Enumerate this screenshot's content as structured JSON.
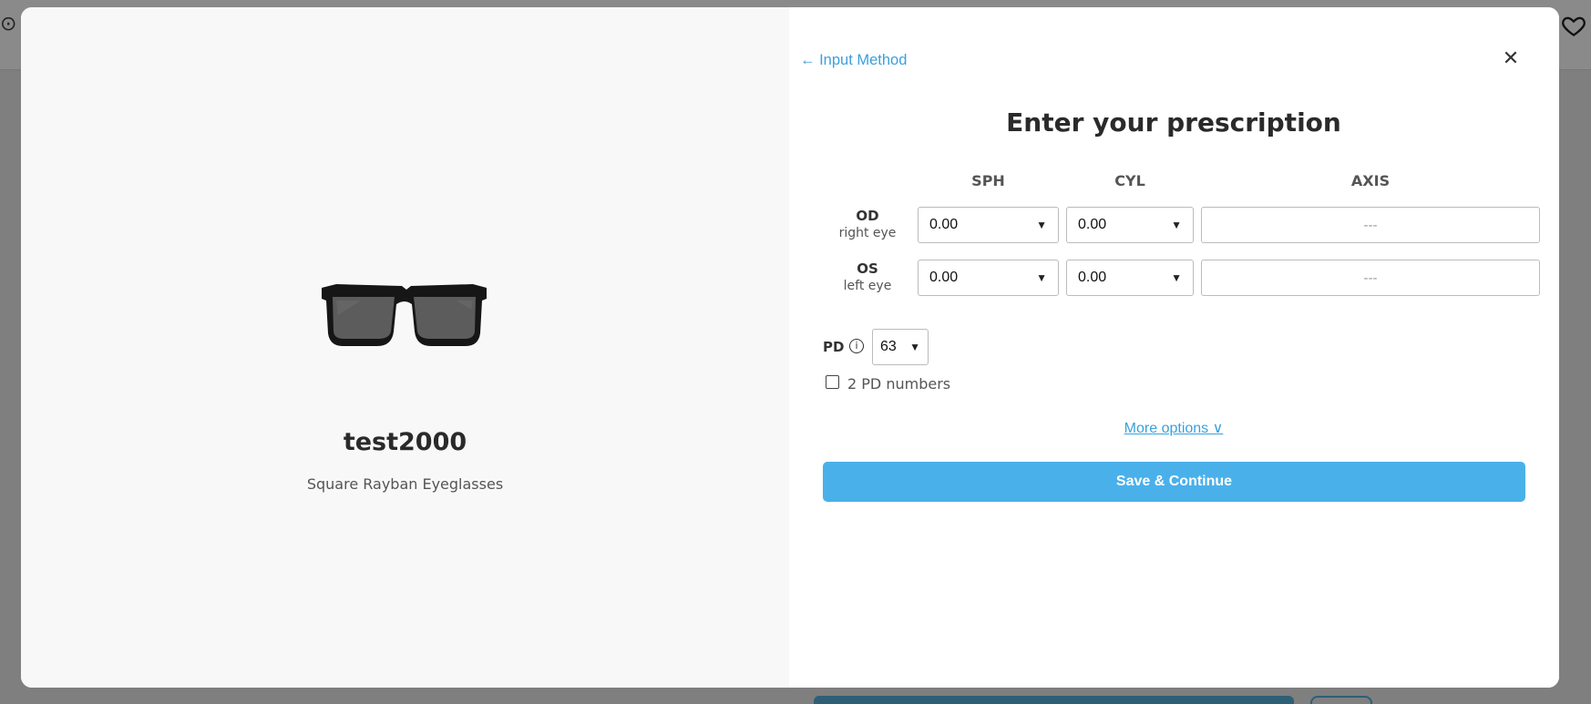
{
  "background": {
    "heart_icon": "heart-icon"
  },
  "product": {
    "name": "test2000",
    "subtitle": "Square Rayban Eyeglasses"
  },
  "form": {
    "back_label": "← Input Method",
    "close_label": "✕",
    "title": "Enter your prescription",
    "columns": {
      "sph": "SPH",
      "cyl": "CYL",
      "axis": "AXIS"
    },
    "od": {
      "label": "OD",
      "sub": "right eye",
      "sph": "0.00",
      "cyl": "0.00",
      "axis_placeholder": "---"
    },
    "os": {
      "label": "OS",
      "sub": "left eye",
      "sph": "0.00",
      "cyl": "0.00",
      "axis_placeholder": "---"
    },
    "pd": {
      "label": "PD",
      "info_icon": "ⓘ",
      "value": "63"
    },
    "two_pd_label": "2 PD numbers",
    "two_pd_checked": false,
    "more_options": "More options ∨",
    "save_label": "Save & Continue"
  },
  "colors": {
    "accent": "#4ab0ea",
    "link": "#3aa0dc",
    "left_pane": "#f8f8f8"
  }
}
